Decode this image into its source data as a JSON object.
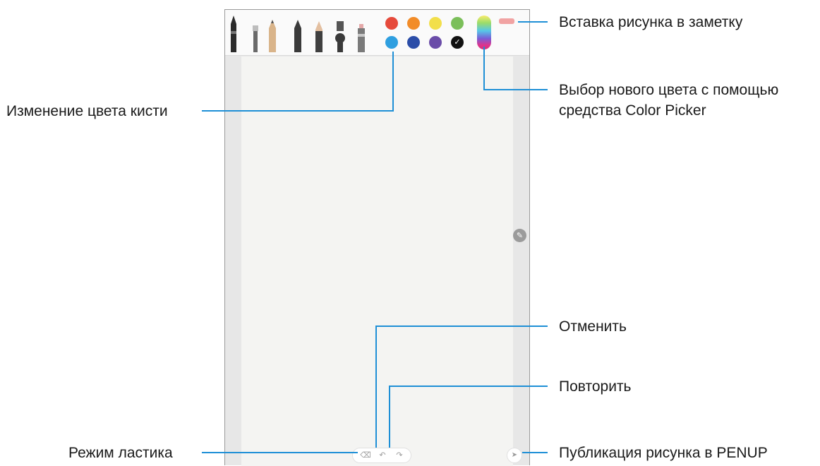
{
  "callouts": {
    "insert_image": "Вставка рисунка в заметку",
    "color_picker_line1": "Выбор нового цвета с помощью",
    "color_picker_line2": "средства Color Picker",
    "brush_color": "Изменение цвета кисти",
    "undo": "Отменить",
    "redo": "Повторить",
    "eraser_mode": "Режим ластика",
    "publish_penup": "Публикация рисунка в PENUP"
  },
  "toolbar": {
    "tools": [
      "fountain-pen",
      "calligraphy-brush",
      "pencil",
      "marker",
      "chisel-marker",
      "ink-pen",
      "highlighter"
    ],
    "colors_row1": [
      "#e64a3b",
      "#f28c28",
      "#f2df4a",
      "#7bbf5a"
    ],
    "colors_row2": [
      "#2f9fe0",
      "#2b4da8",
      "#6a4ca8",
      "#111111"
    ],
    "selected_color": "#111111"
  },
  "icons": {
    "eraser": "eraser-icon",
    "undo": "undo-icon",
    "redo": "redo-icon",
    "share": "send-icon",
    "pen": "pen-icon"
  },
  "colors": {
    "callout_line": "#1e8fd6",
    "canvas": "#f4f4f2",
    "frame": "#e7e7e7"
  }
}
